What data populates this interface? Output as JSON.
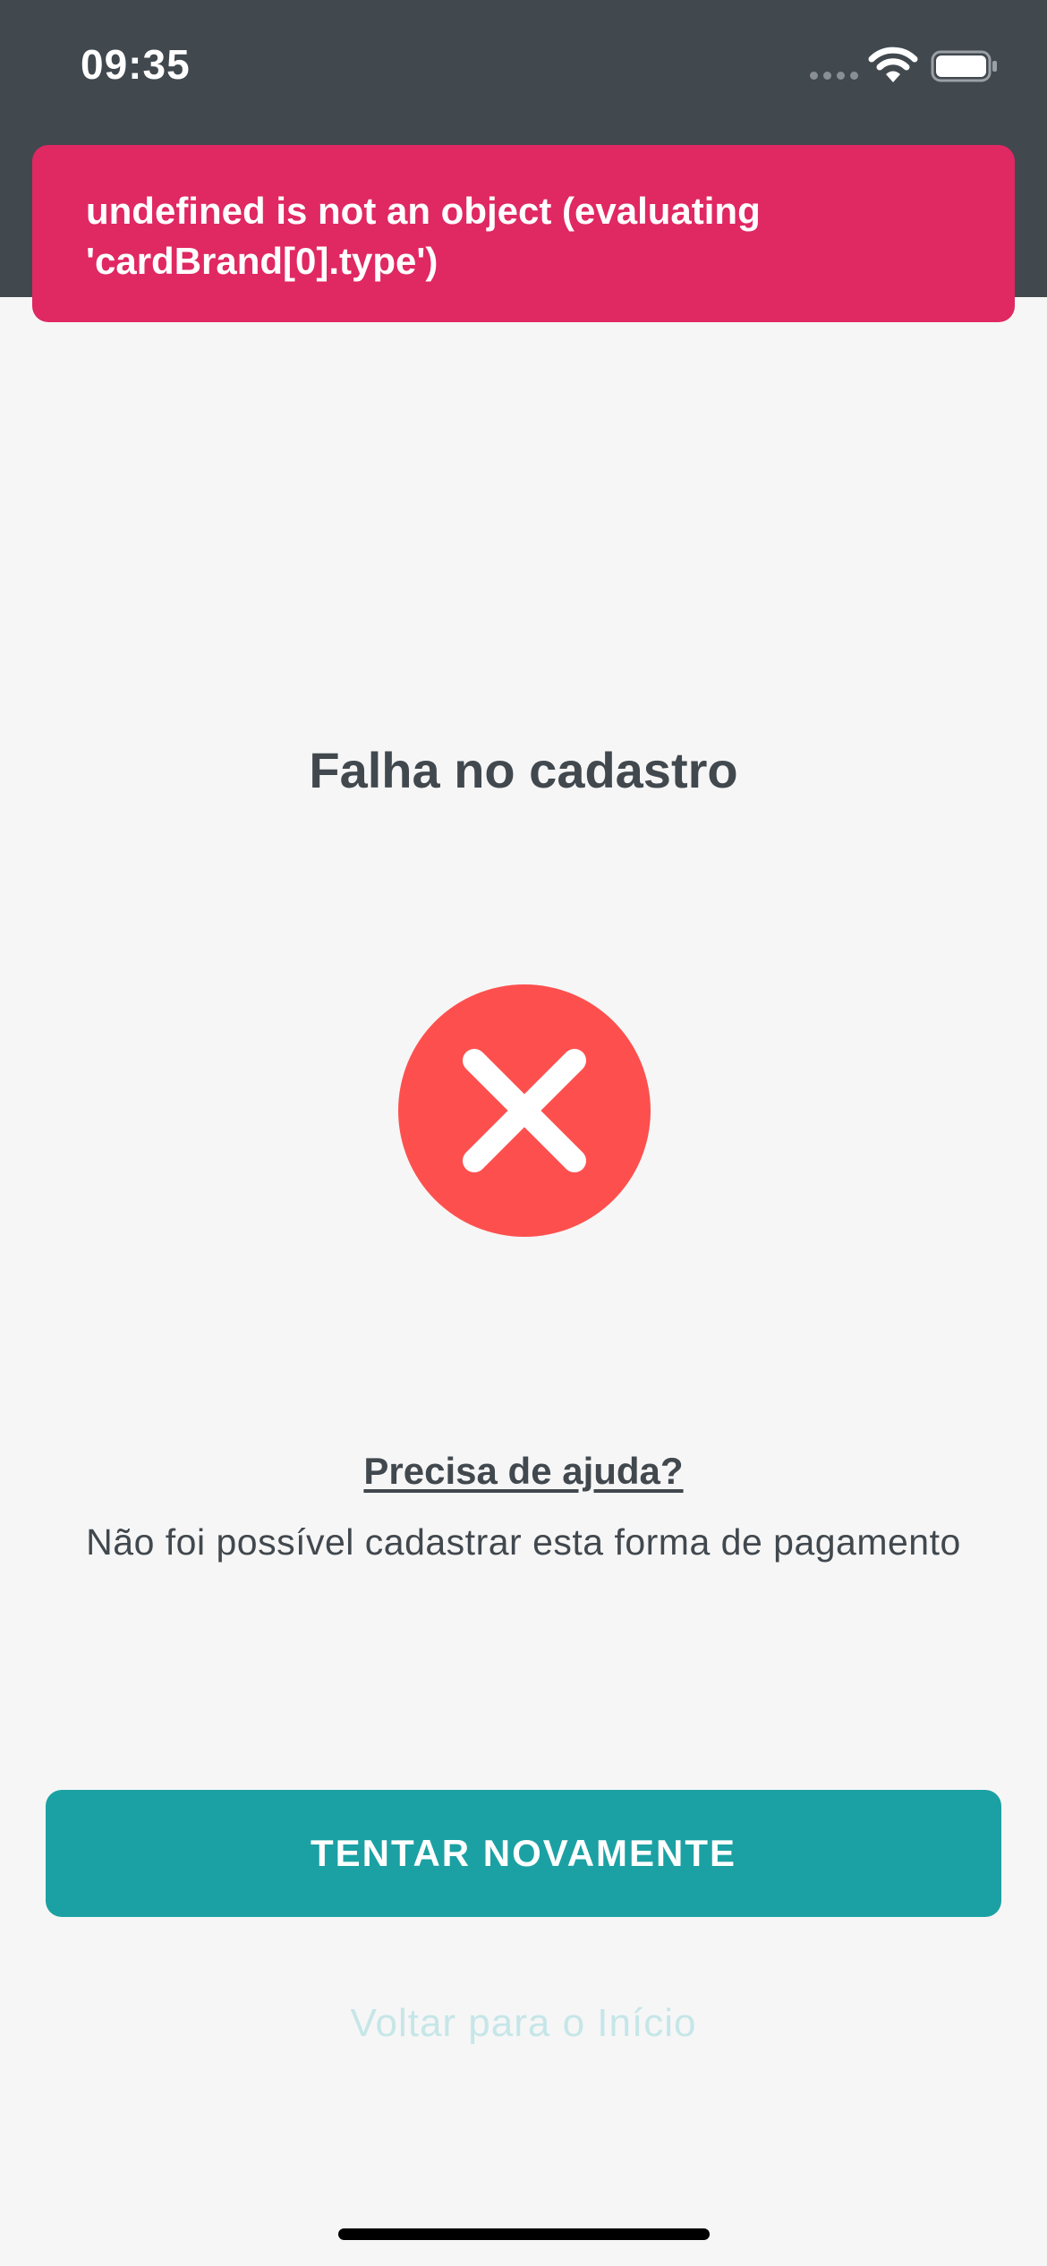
{
  "status_bar": {
    "time": "09:35",
    "background_color": "#41484e",
    "signal_icon": "signal-dots-icon",
    "wifi_icon": "wifi-icon",
    "battery_icon": "battery-icon"
  },
  "toast": {
    "message": "undefined is not an object (evaluating 'cardBrand[0].type')",
    "background_color": "#e02863"
  },
  "main": {
    "title": "Falha no cadastro",
    "status_icon": "error-x-icon",
    "status_icon_color": "#fd504e",
    "help_link": "Precisa de ajuda?",
    "description": "Não foi possível cadastrar esta forma de pagamento"
  },
  "actions": {
    "retry_label": "TENTAR NOVAMENTE",
    "retry_color": "#1ba1a3",
    "back_label": "Voltar para o Início"
  }
}
